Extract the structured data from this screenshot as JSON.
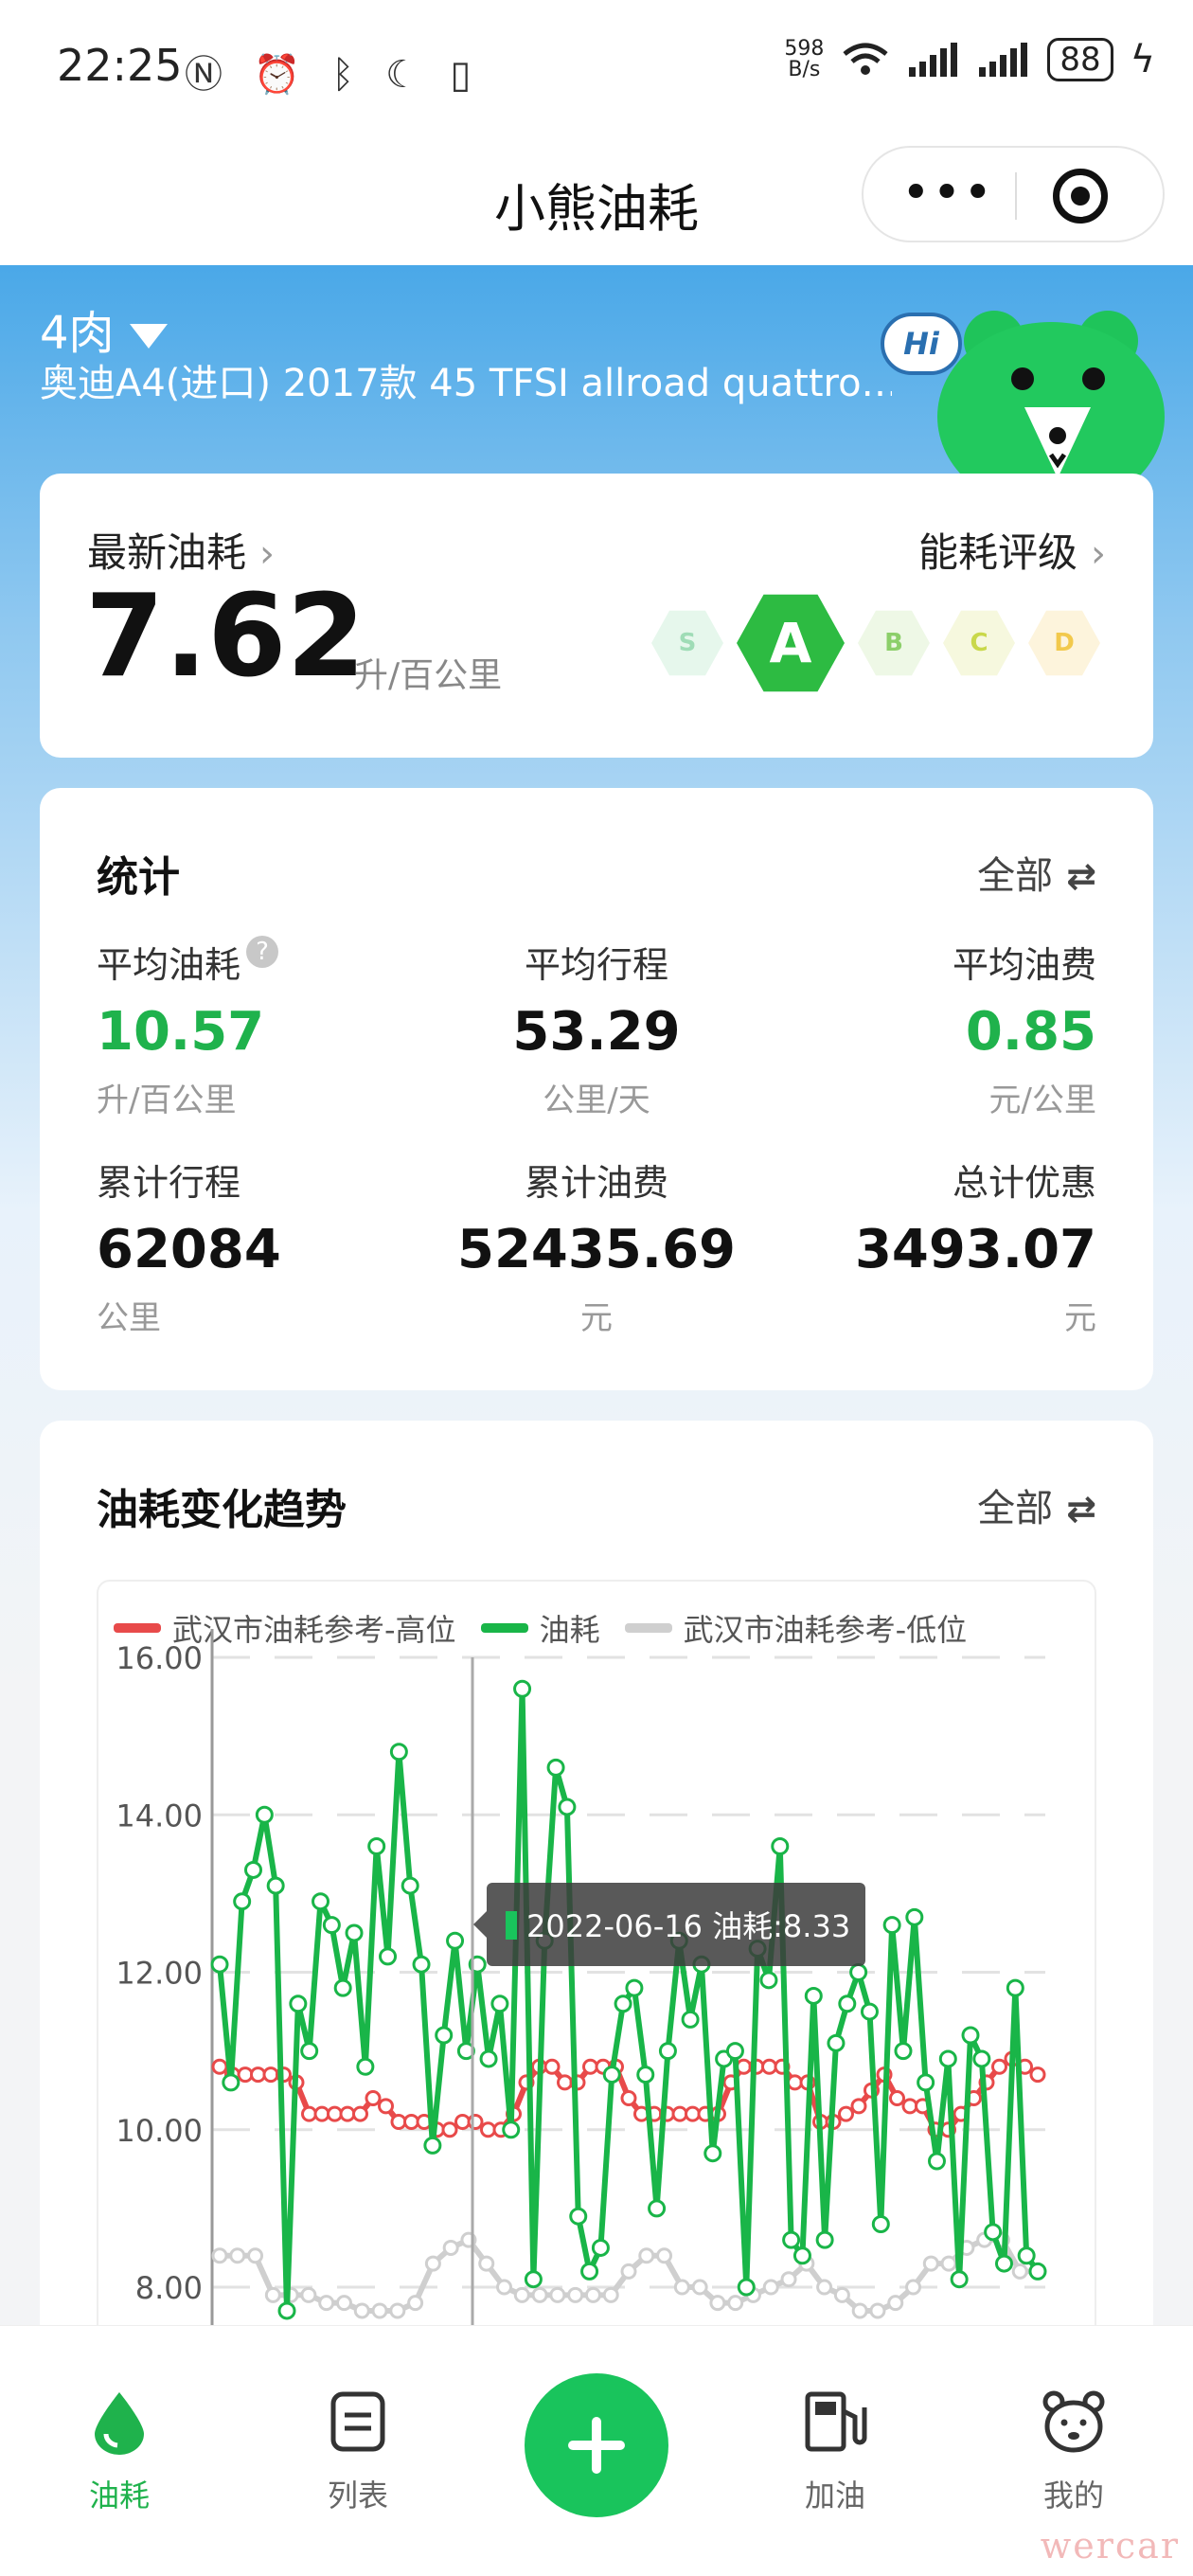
{
  "status_bar": {
    "time": "22:25",
    "net_speed_value": "598",
    "net_speed_unit": "B/s",
    "battery": "88"
  },
  "title_bar": {
    "title": "小熊油耗"
  },
  "car": {
    "name": "4肉",
    "model": "奥迪A4(进口) 2017款 45 TFSI allroad quattro…",
    "mascot_text": "Hi"
  },
  "latest": {
    "label": "最新油耗",
    "value": "7.62",
    "unit": "升/百公里",
    "rating_label": "能耗评级",
    "grades": [
      {
        "letter": "S",
        "color": "#9fdcb6",
        "bg": "#e6f7ec"
      },
      {
        "letter": "A",
        "color": "#ffffff",
        "bg": "#2dbb42"
      },
      {
        "letter": "B",
        "color": "#8ccf6a",
        "bg": "#eef8e6"
      },
      {
        "letter": "C",
        "color": "#c9d84a",
        "bg": "#f6f8de"
      },
      {
        "letter": "D",
        "color": "#f2c94c",
        "bg": "#fdf4dc"
      }
    ],
    "active_grade": "A"
  },
  "stats": {
    "title": "统计",
    "filter": "全部",
    "items": [
      {
        "label": "平均油耗",
        "value": "10.57",
        "unit": "升/百公里"
      },
      {
        "label": "平均行程",
        "value": "53.29",
        "unit": "公里/天"
      },
      {
        "label": "平均油费",
        "value": "0.85",
        "unit": "元/公里"
      },
      {
        "label": "累计行程",
        "value": "62084",
        "unit": "公里"
      },
      {
        "label": "累计油费",
        "value": "52435.69",
        "unit": "元"
      },
      {
        "label": "总计优惠",
        "value": "3493.07",
        "unit": "元"
      }
    ]
  },
  "trend": {
    "title": "油耗变化趋势",
    "filter": "全部",
    "tooltip": "2022-06-16 油耗:8.33"
  },
  "chart_data": {
    "type": "line",
    "ylim": [
      7.2,
      16
    ],
    "yticks": [
      "16.00",
      "14.00",
      "12.00",
      "10.00",
      "8.00"
    ],
    "series": [
      {
        "name": "武汉市油耗参考-高位",
        "color": "#e84a4a",
        "values": [
          10.8,
          10.7,
          10.7,
          10.7,
          10.7,
          10.7,
          10.6,
          10.2,
          10.2,
          10.2,
          10.2,
          10.2,
          10.4,
          10.3,
          10.1,
          10.1,
          10.1,
          10.0,
          10.0,
          10.1,
          10.1,
          10.0,
          10.0,
          10.2,
          10.6,
          10.8,
          10.8,
          10.6,
          10.6,
          10.8,
          10.8,
          10.8,
          10.4,
          10.2,
          10.2,
          10.2,
          10.2,
          10.2,
          10.2,
          10.2,
          10.6,
          10.8,
          10.8,
          10.8,
          10.8,
          10.6,
          10.6,
          10.1,
          10.1,
          10.2,
          10.3,
          10.5,
          10.7,
          10.4,
          10.3,
          10.3,
          10.0,
          10.0,
          10.2,
          10.4,
          10.6,
          10.8,
          10.9,
          10.8,
          10.7
        ]
      },
      {
        "name": "油耗",
        "color": "#19b548",
        "values": [
          12.1,
          10.6,
          12.9,
          13.3,
          14.0,
          13.1,
          7.7,
          11.6,
          11.0,
          12.9,
          12.6,
          11.8,
          12.5,
          10.8,
          13.6,
          12.2,
          14.8,
          13.1,
          12.1,
          9.8,
          11.2,
          12.4,
          11.0,
          12.1,
          10.9,
          11.6,
          10.0,
          15.6,
          8.1,
          12.4,
          14.6,
          14.1,
          8.9,
          8.2,
          8.5,
          10.7,
          11.6,
          11.8,
          10.7,
          9.0,
          11.0,
          12.4,
          11.4,
          12.1,
          9.7,
          10.9,
          11.0,
          8.0,
          12.3,
          11.9,
          13.6,
          8.6,
          8.4,
          11.7,
          8.6,
          11.1,
          11.6,
          12.0,
          11.5,
          8.8,
          12.6,
          11.0,
          12.7,
          10.6,
          9.6,
          10.9,
          8.1,
          11.2,
          10.9,
          8.7,
          8.3,
          11.8,
          8.4,
          8.2
        ]
      },
      {
        "name": "武汉市油耗参考-低位",
        "color": "#cfcfcf",
        "values": [
          8.4,
          8.4,
          8.4,
          7.9,
          7.9,
          7.9,
          7.8,
          7.8,
          7.7,
          7.7,
          7.7,
          7.8,
          8.3,
          8.5,
          8.6,
          8.3,
          8.0,
          7.9,
          7.9,
          7.9,
          7.9,
          7.9,
          7.9,
          8.2,
          8.4,
          8.4,
          8.0,
          8.0,
          7.8,
          7.8,
          7.9,
          8.0,
          8.1,
          8.3,
          8.0,
          7.9,
          7.7,
          7.7,
          7.8,
          8.0,
          8.3,
          8.3,
          8.5,
          8.6,
          8.6,
          8.2,
          8.2
        ]
      }
    ],
    "tooltip": {
      "date": "2022-06-16",
      "label": "油耗",
      "value": 8.33
    }
  },
  "nav": {
    "items": [
      {
        "label": "油耗",
        "icon": "drop-icon",
        "active": true
      },
      {
        "label": "列表",
        "icon": "list-icon",
        "active": false
      },
      {
        "label": "加油",
        "icon": "fuel-pump-icon",
        "active": false
      },
      {
        "label": "我的",
        "icon": "bear-face-icon",
        "active": false
      }
    ]
  },
  "watermark": "wercar"
}
